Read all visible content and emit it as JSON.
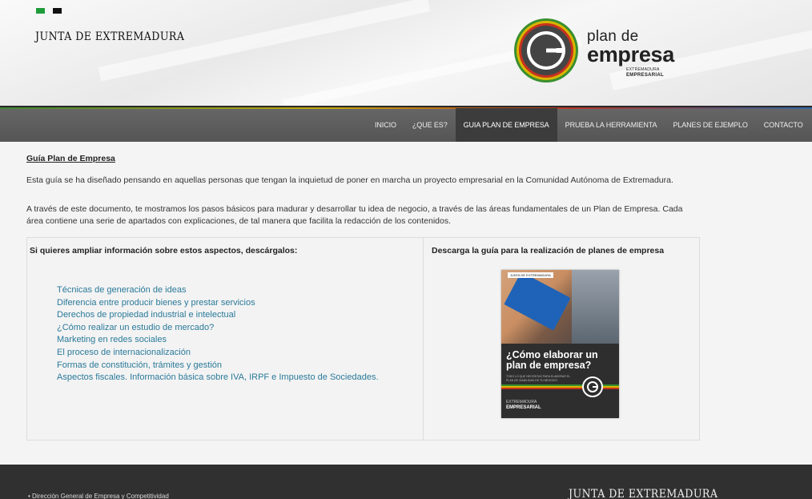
{
  "header": {
    "brand": "JUNTA DE EXTREMADURA",
    "logo": {
      "line1": "plan de",
      "line2": "empresa",
      "line3": "EXTREMADURA",
      "line4": "EMPRESARIAL",
      "icon": "power-g-icon"
    },
    "flag_colors": [
      "#1f9c3a",
      "#111111"
    ]
  },
  "nav": {
    "items": [
      "INICIO",
      "¿QUE ES?",
      "GUIA PLAN DE EMPRESA",
      "PRUEBA LA HERRAMIENTA",
      "PLANES DE EJEMPLO",
      "CONTACTO"
    ],
    "active": "GUIA PLAN DE EMPRESA"
  },
  "main": {
    "title": "Guía Plan de Empresa",
    "paragraph1": "Esta guía se ha diseñado pensando en aquellas personas que tengan la inquietud de poner en marcha un proyecto empresarial en la Comunidad Autónoma de Extremadura.",
    "paragraph2": "A través de este documento, te mostramos los pasos básicos para madurar y desarrollar tu idea de negocio, a través de las áreas fundamentales de un Plan de Empresa. Cada área contiene una serie de apartados con explicaciones, de tal manera que facilita la redacción de los contenidos.",
    "left_title": "Si quieres ampliar información sobre estos aspectos, descárgalos:",
    "links": [
      "Técnicas de generación de ideas",
      "Diferencia entre producir bienes y prestar servicios",
      "Derechos de propiedad industrial e intelectual",
      "¿Cómo realizar un estudio de mercado?",
      "Marketing en redes sociales",
      "El proceso de internacionalización",
      "Formas de constitución, trámites y gestión",
      "Aspectos fiscales. Información básica sobre IVA, IRPF e Impuesto de Sociedades."
    ],
    "right_title": "Descarga la guía para la realización de planes de empresa",
    "cover": {
      "tag": "JUNTA DE EXTREMADURA",
      "question": "¿Cómo elaborar un plan de empresa?",
      "small": "TODO LO QUE NECESITAS PARA ELABORAR EL PLAN DE VIABILIDAD DE TU NEGOCIO",
      "ext1": "EXTREMADURA",
      "ext2": "EMPRESARIAL"
    }
  },
  "footer": {
    "link": "• Dirección General de Empresa y Competitividad",
    "brand": "JUNTA DE EXTREMADURA"
  },
  "colors": {
    "link": "#2a7a9a",
    "nav_bg": "#5e5e5e",
    "nav_active": "#3c3c3c",
    "footer_bg": "#303030"
  }
}
